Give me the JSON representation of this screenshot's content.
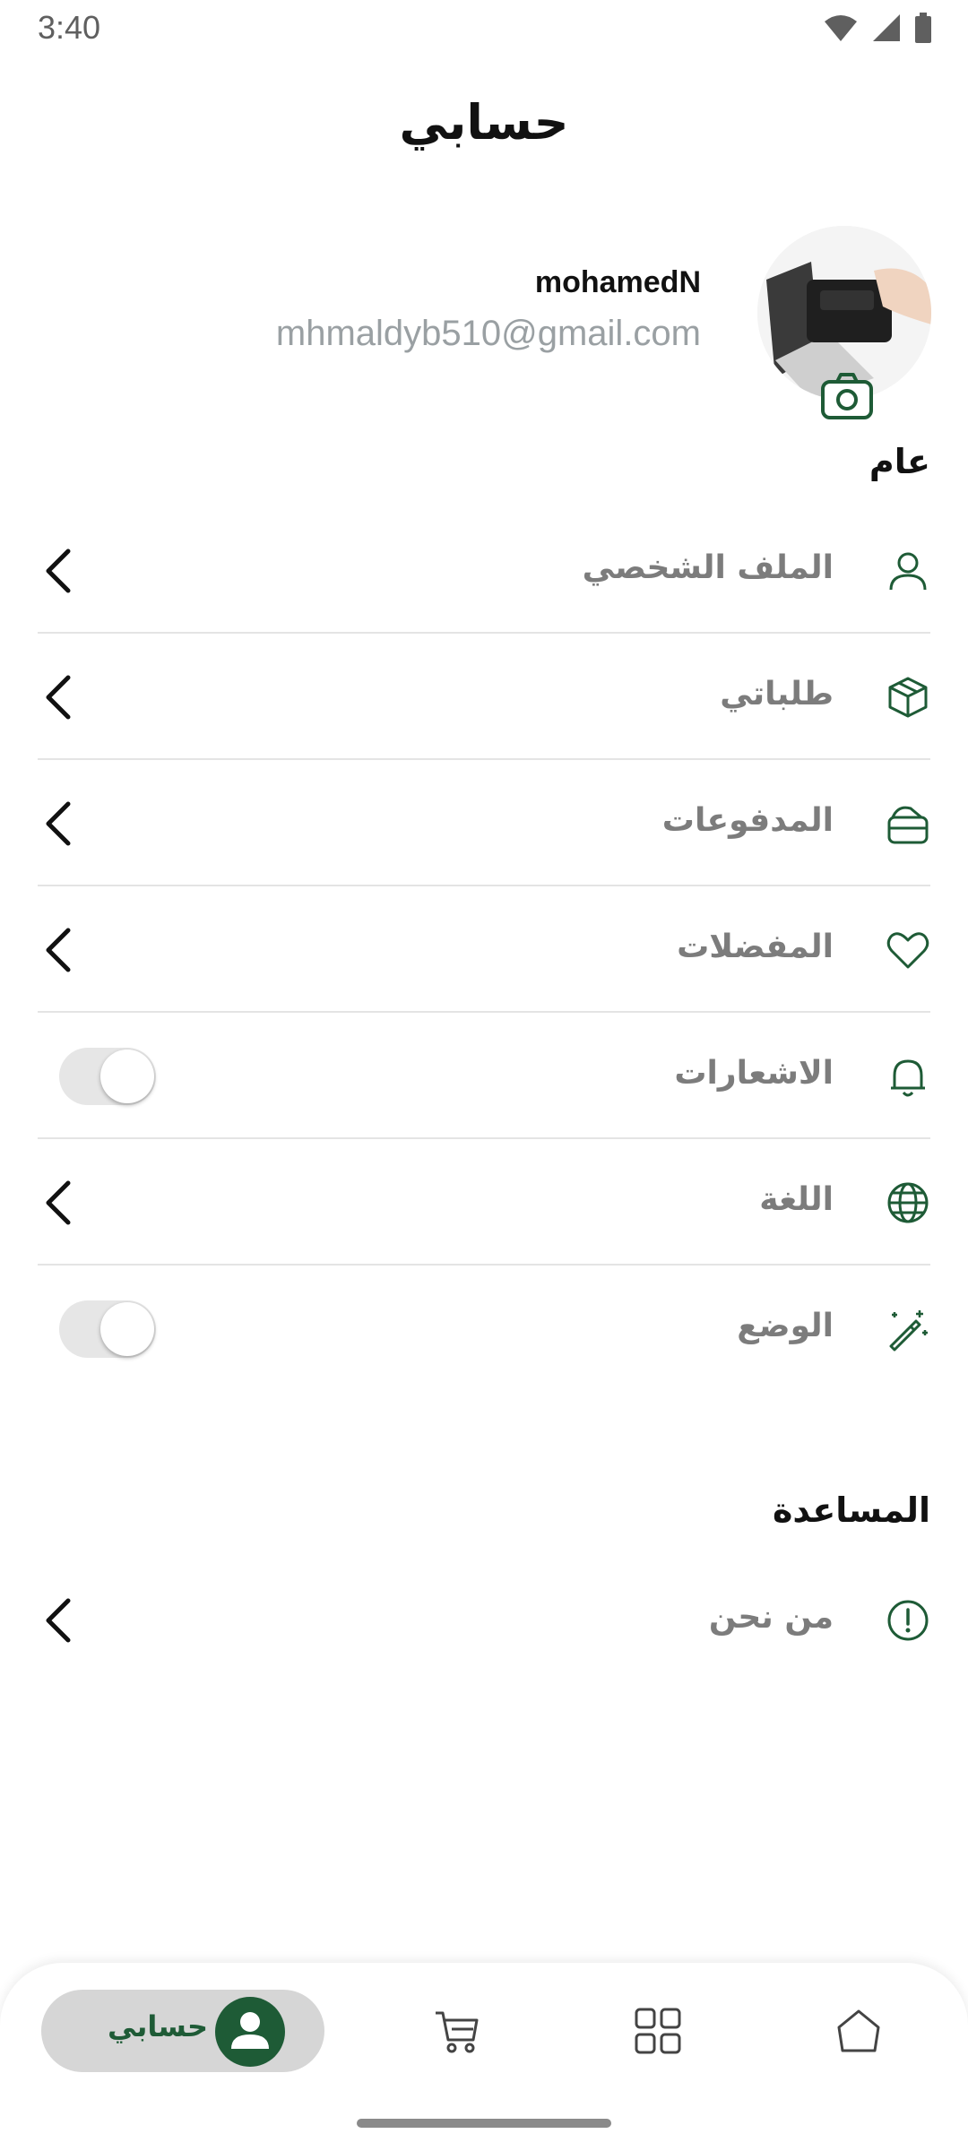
{
  "status_bar": {
    "time": "3:40"
  },
  "header": {
    "title": "حسابي"
  },
  "profile": {
    "name": "mohamedN",
    "email": "mhmaldyb510@gmail.com",
    "avatar_icon": "profile-photo",
    "camera_icon": "camera-icon"
  },
  "sections": {
    "general": "عام",
    "help": "المساعدة"
  },
  "menu": [
    {
      "label": "الملف الشخصي",
      "icon": "user-icon"
    },
    {
      "label": "طلباتي",
      "icon": "box-icon"
    },
    {
      "label": "المدفوعات",
      "icon": "wallet-icon"
    },
    {
      "label": "المفضلات",
      "icon": "heart-icon"
    },
    {
      "label": "الاشعارات",
      "icon": "bell-icon",
      "toggle": false
    },
    {
      "label": "اللغة",
      "icon": "globe-icon"
    },
    {
      "label": "الوضع",
      "icon": "magic-wand-icon",
      "toggle": false
    }
  ],
  "help_menu": [
    {
      "label": "من نحن",
      "icon": "info-icon"
    }
  ],
  "bottom_nav": {
    "active_label": "حسابي",
    "items": [
      "account",
      "cart",
      "categories",
      "home"
    ]
  },
  "colors": {
    "accent": "#1e5b36",
    "muted_text": "#7c7c7c"
  }
}
